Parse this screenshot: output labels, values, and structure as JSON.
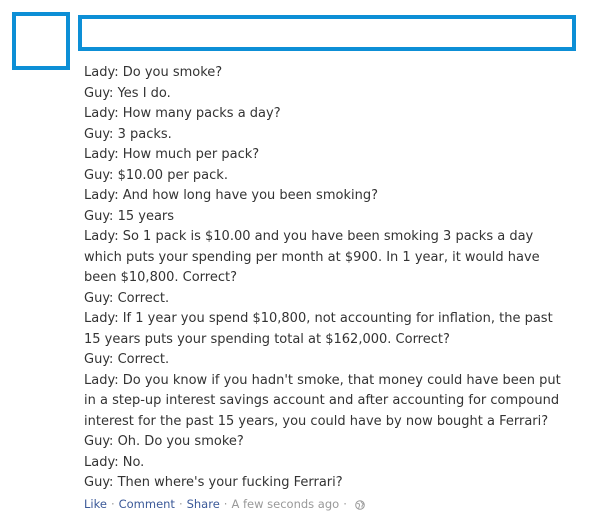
{
  "post": {
    "lines": [
      "Lady: Do you smoke?",
      "Guy: Yes I do.",
      "Lady: How many packs a day?",
      "Guy: 3 packs.",
      "Lady: How much per pack?",
      "Guy: $10.00 per pack.",
      "Lady: And how long have you been smoking?",
      "Guy: 15 years",
      "Lady: So 1 pack is $10.00 and you have been smoking 3 packs a day",
      "which puts your spending per month at $900. In 1 year, it would have",
      "been $10,800. Correct?",
      "Guy: Correct.",
      "Lady: If 1 year you spend $10,800, not accounting for inflation, the past",
      "15 years puts your spending total at $162,000. Correct?",
      "Guy: Correct.",
      "Lady: Do you know if you hadn't smoke, that money could have been put",
      "in a step-up interest savings account and after accounting for compound",
      "interest for the past 15 years, you could have by now bought a Ferrari?",
      "Guy: Oh. Do you smoke?",
      "Lady: No.",
      "Guy: Then where's your fucking Ferrari?"
    ]
  },
  "footer": {
    "like_label": "Like",
    "comment_label": "Comment",
    "share_label": "Share",
    "timestamp": "A few seconds ago",
    "separator": "·",
    "privacy_icon": "globe-icon"
  },
  "colors": {
    "redaction_border": "#0d8fd6",
    "link": "#3b5998",
    "meta": "#999999",
    "text": "#333333"
  }
}
